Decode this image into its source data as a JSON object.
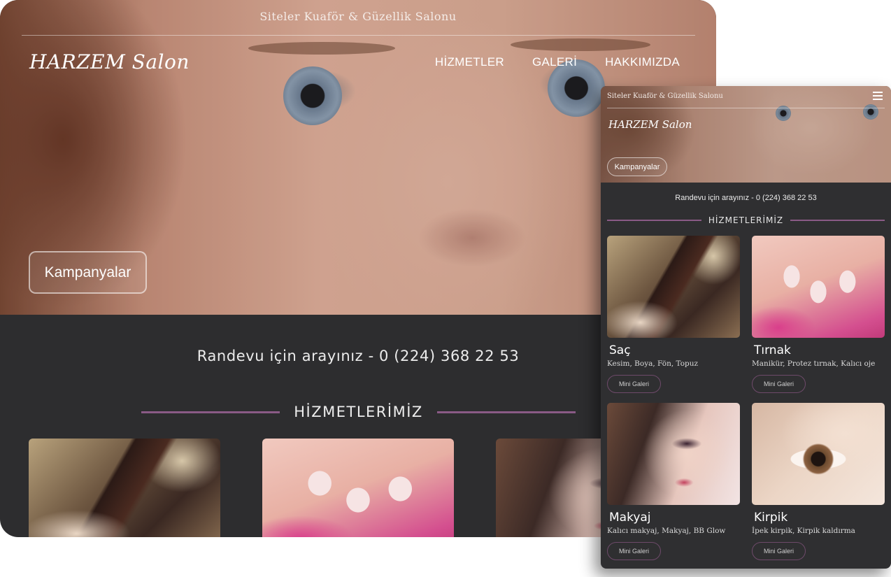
{
  "desktop": {
    "tagline": "Siteler Kuaför & Güzellik Salonu",
    "logo": "HARZEM Salon",
    "nav": [
      "HİZMETLER",
      "GALERİ",
      "HAKKIMIZDA"
    ],
    "campaign_button": "Kampanyalar",
    "phone_line": "Randevu için arayınız - 0 (224) 368 22 53",
    "section_title": "HİZMETLERİMİZ"
  },
  "mobile": {
    "tagline": "Siteler Kuaför & Güzellik Salonu",
    "menu_icon": "hamburger-icon",
    "logo": "HARZEM Salon",
    "campaign_button": "Kampanyalar",
    "phone_line": "Randevu için arayınız - 0 (224) 368 22 53",
    "section_title": "HİZMETLERİMİZ",
    "services": [
      {
        "name": "Saç",
        "desc": "Kesim, Boya, Fön, Topuz",
        "button": "Mini Galeri"
      },
      {
        "name": "Tırnak",
        "desc": "Manikür, Protez tırnak, Kalıcı oje",
        "button": "Mini Galeri"
      },
      {
        "name": "Makyaj",
        "desc": "Kalıcı makyaj, Makyaj, BB Glow",
        "button": "Mini Galeri"
      },
      {
        "name": "Kirpik",
        "desc": "İpek kirpik, Kirpik kaldırma",
        "button": "Mini Galeri"
      }
    ]
  },
  "colors": {
    "accent_line": "#8a5a86",
    "dark_bg": "#2d2d2f"
  }
}
